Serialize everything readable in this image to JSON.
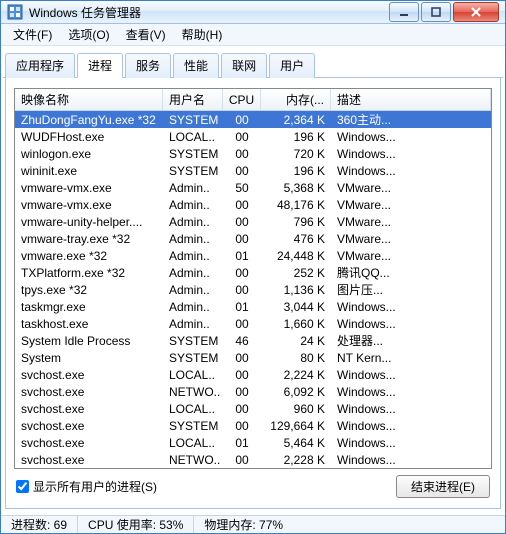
{
  "window": {
    "title": "Windows 任务管理器"
  },
  "menubar": [
    "文件(F)",
    "选项(O)",
    "查看(V)",
    "帮助(H)"
  ],
  "tabs": [
    "应用程序",
    "进程",
    "服务",
    "性能",
    "联网",
    "用户"
  ],
  "active_tab": 1,
  "columns": {
    "name": "映像名称",
    "user": "用户名",
    "cpu": "CPU",
    "mem": "内存(...",
    "desc": "描述"
  },
  "processes": [
    {
      "name": "ZhuDongFangYu.exe *32",
      "user": "SYSTEM",
      "cpu": "00",
      "mem": "2,364 K",
      "desc": "360主动..."
    },
    {
      "name": "WUDFHost.exe",
      "user": "LOCAL..",
      "cpu": "00",
      "mem": "196 K",
      "desc": "Windows..."
    },
    {
      "name": "winlogon.exe",
      "user": "SYSTEM",
      "cpu": "00",
      "mem": "720 K",
      "desc": "Windows..."
    },
    {
      "name": "wininit.exe",
      "user": "SYSTEM",
      "cpu": "00",
      "mem": "196 K",
      "desc": "Windows..."
    },
    {
      "name": "vmware-vmx.exe",
      "user": "Admin..",
      "cpu": "50",
      "mem": "5,368 K",
      "desc": "VMware..."
    },
    {
      "name": "vmware-vmx.exe",
      "user": "Admin..",
      "cpu": "00",
      "mem": "48,176 K",
      "desc": "VMware..."
    },
    {
      "name": "vmware-unity-helper....",
      "user": "Admin..",
      "cpu": "00",
      "mem": "796 K",
      "desc": "VMware..."
    },
    {
      "name": "vmware-tray.exe *32",
      "user": "Admin..",
      "cpu": "00",
      "mem": "476 K",
      "desc": "VMware..."
    },
    {
      "name": "vmware.exe *32",
      "user": "Admin..",
      "cpu": "01",
      "mem": "24,448 K",
      "desc": "VMware..."
    },
    {
      "name": "TXPlatform.exe *32",
      "user": "Admin..",
      "cpu": "00",
      "mem": "252 K",
      "desc": "腾讯QQ..."
    },
    {
      "name": "tpys.exe *32",
      "user": "Admin..",
      "cpu": "00",
      "mem": "1,136 K",
      "desc": "图片压..."
    },
    {
      "name": "taskmgr.exe",
      "user": "Admin..",
      "cpu": "01",
      "mem": "3,044 K",
      "desc": "Windows..."
    },
    {
      "name": "taskhost.exe",
      "user": "Admin..",
      "cpu": "00",
      "mem": "1,660 K",
      "desc": "Windows..."
    },
    {
      "name": "System Idle Process",
      "user": "SYSTEM",
      "cpu": "46",
      "mem": "24 K",
      "desc": "处理器..."
    },
    {
      "name": "System",
      "user": "SYSTEM",
      "cpu": "00",
      "mem": "80 K",
      "desc": "NT Kern..."
    },
    {
      "name": "svchost.exe",
      "user": "LOCAL..",
      "cpu": "00",
      "mem": "2,224 K",
      "desc": "Windows..."
    },
    {
      "name": "svchost.exe",
      "user": "NETWO..",
      "cpu": "00",
      "mem": "6,092 K",
      "desc": "Windows..."
    },
    {
      "name": "svchost.exe",
      "user": "LOCAL..",
      "cpu": "00",
      "mem": "960 K",
      "desc": "Windows..."
    },
    {
      "name": "svchost.exe",
      "user": "SYSTEM",
      "cpu": "00",
      "mem": "129,664 K",
      "desc": "Windows..."
    },
    {
      "name": "svchost.exe",
      "user": "LOCAL..",
      "cpu": "01",
      "mem": "5,464 K",
      "desc": "Windows..."
    },
    {
      "name": "svchost.exe",
      "user": "NETWO..",
      "cpu": "00",
      "mem": "2,228 K",
      "desc": "Windows..."
    }
  ],
  "selected_row": 0,
  "show_all_users_label": "显示所有用户的进程(S)",
  "show_all_users_checked": true,
  "end_process_label": "结束进程(E)",
  "status": {
    "proc_count_label": "进程数: 69",
    "cpu_label": "CPU 使用率: 53%",
    "mem_label": "物理内存: 77%"
  }
}
